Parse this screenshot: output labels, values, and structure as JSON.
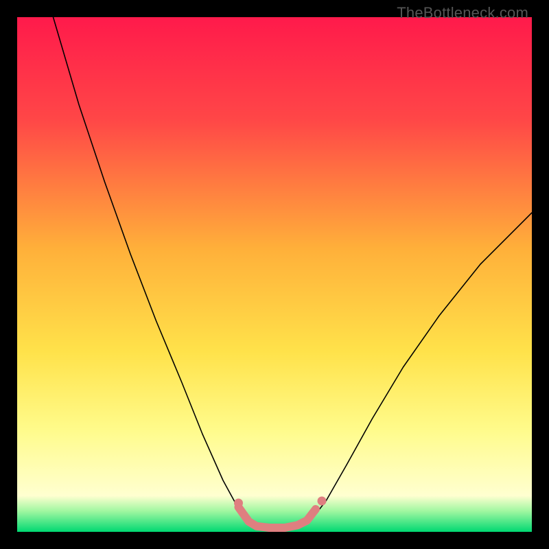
{
  "watermark": "TheBottleneck.com",
  "chart_data": {
    "type": "line",
    "title": "",
    "xlabel": "",
    "ylabel": "",
    "xlim": [
      0,
      100
    ],
    "ylim": [
      0,
      100
    ],
    "gradient_stops": [
      {
        "offset": 0.0,
        "color": "#ff1a4b"
      },
      {
        "offset": 0.2,
        "color": "#ff4747"
      },
      {
        "offset": 0.45,
        "color": "#ffb03a"
      },
      {
        "offset": 0.65,
        "color": "#ffe24a"
      },
      {
        "offset": 0.8,
        "color": "#fffb8a"
      },
      {
        "offset": 0.93,
        "color": "#ffffd0"
      },
      {
        "offset": 0.96,
        "color": "#9ff7a0"
      },
      {
        "offset": 1.0,
        "color": "#00d972"
      }
    ],
    "series": [
      {
        "name": "curve",
        "color": "#000000",
        "width": 1.6,
        "points": [
          {
            "x": 7.0,
            "y": 100.0
          },
          {
            "x": 12.0,
            "y": 83.0
          },
          {
            "x": 17.0,
            "y": 68.0
          },
          {
            "x": 22.0,
            "y": 54.0
          },
          {
            "x": 27.0,
            "y": 41.0
          },
          {
            "x": 32.0,
            "y": 29.0
          },
          {
            "x": 36.0,
            "y": 19.0
          },
          {
            "x": 40.0,
            "y": 10.0
          },
          {
            "x": 43.0,
            "y": 4.5
          },
          {
            "x": 45.0,
            "y": 1.8
          },
          {
            "x": 46.5,
            "y": 0.8
          },
          {
            "x": 49.0,
            "y": 0.4
          },
          {
            "x": 52.0,
            "y": 0.4
          },
          {
            "x": 55.0,
            "y": 0.8
          },
          {
            "x": 57.0,
            "y": 2.2
          },
          {
            "x": 60.0,
            "y": 6.0
          },
          {
            "x": 64.0,
            "y": 13.0
          },
          {
            "x": 69.0,
            "y": 22.0
          },
          {
            "x": 75.0,
            "y": 32.0
          },
          {
            "x": 82.0,
            "y": 42.0
          },
          {
            "x": 90.0,
            "y": 52.0
          },
          {
            "x": 100.0,
            "y": 62.0
          }
        ]
      },
      {
        "name": "highlight-range",
        "color": "#df7f80",
        "width": 12,
        "points": [
          {
            "x": 43.0,
            "y": 4.8
          },
          {
            "x": 45.0,
            "y": 2.0
          },
          {
            "x": 46.5,
            "y": 1.1
          },
          {
            "x": 49.0,
            "y": 0.8
          },
          {
            "x": 52.0,
            "y": 0.8
          },
          {
            "x": 54.5,
            "y": 1.3
          },
          {
            "x": 56.3,
            "y": 2.2
          },
          {
            "x": 58.0,
            "y": 4.4
          }
        ]
      },
      {
        "name": "highlight-dot-left",
        "type": "scatter",
        "color": "#df7f80",
        "radius": 6.5,
        "points": [
          {
            "x": 43.0,
            "y": 5.6
          }
        ]
      },
      {
        "name": "highlight-dot-right-gap",
        "type": "scatter",
        "color": "#df7f80",
        "radius": 6.5,
        "points": [
          {
            "x": 59.2,
            "y": 6.0
          }
        ]
      },
      {
        "name": "highlight-dot-right-end",
        "type": "scatter",
        "color": "#df7f80",
        "radius": 4.5,
        "points": [
          {
            "x": 57.2,
            "y": 3.6
          }
        ]
      }
    ]
  }
}
